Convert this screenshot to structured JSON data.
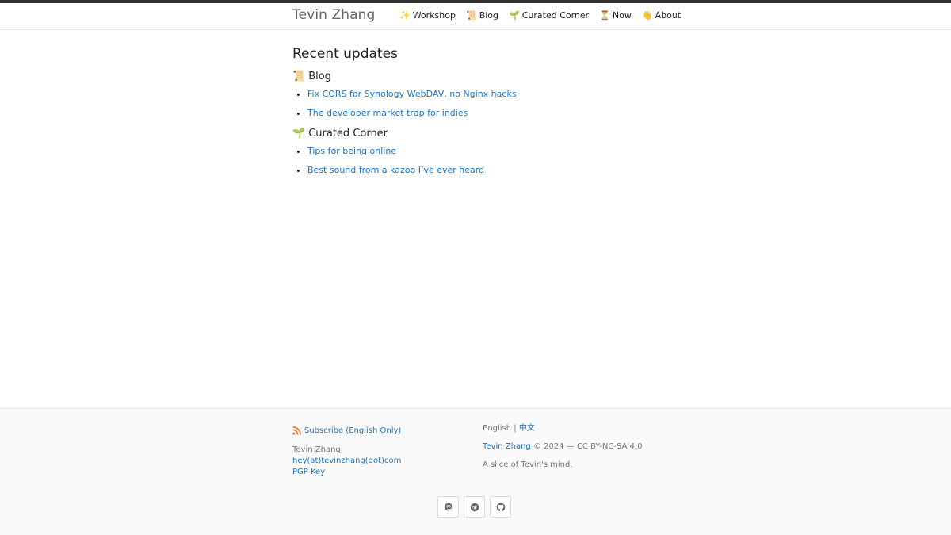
{
  "header": {
    "site_title": "Tevin Zhang",
    "nav": [
      {
        "emoji": "✨",
        "label": "Workshop"
      },
      {
        "emoji": "📜",
        "label": "Blog"
      },
      {
        "emoji": "🌱",
        "label": "Curated Corner"
      },
      {
        "emoji": "⏳",
        "label": "Now"
      },
      {
        "emoji": "👋",
        "label": "About"
      }
    ]
  },
  "main": {
    "heading": "Recent updates",
    "sections": [
      {
        "emoji": "📜",
        "title": "Blog",
        "links": [
          "Fix CORS for Synology WebDAV, no Nginx hacks",
          "The developer market trap for indies"
        ]
      },
      {
        "emoji": "🌱",
        "title": "Curated Corner",
        "links": [
          "Tips for being online",
          "Best sound from a kazoo I’ve ever heard"
        ]
      }
    ]
  },
  "footer": {
    "subscribe_label": "Subscribe (English Only)",
    "author_name": "Tevin Zhang",
    "email": "hey(at)tevinzhang(dot)com",
    "pgp_label": "PGP Key",
    "lang_english": "English",
    "lang_separator": " | ",
    "lang_chinese": "中文",
    "copyright_name": "Tevin Zhang",
    "copyright_rest": " © 2024 — CC BY-NC-SA 4.0",
    "tagline": "A slice of Tevin's mind.",
    "socials": [
      "mastodon-icon",
      "telegram-icon",
      "github-icon"
    ]
  },
  "colors": {
    "link": "#1e73be",
    "rss": "#f26522",
    "topbar": "#333333"
  }
}
